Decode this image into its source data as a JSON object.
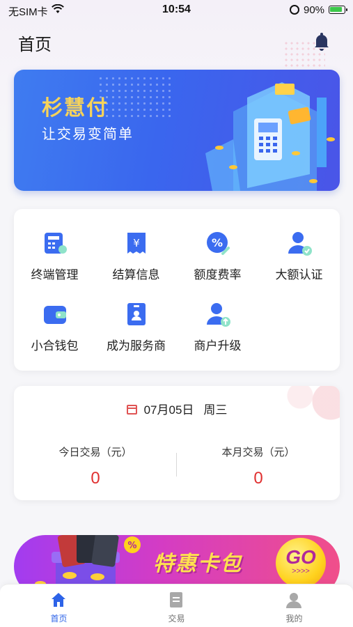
{
  "status_bar": {
    "carrier": "无SIM卡",
    "time": "10:54",
    "battery": "90%"
  },
  "header": {
    "title": "首页",
    "bell_icon": "bell-icon"
  },
  "banner": {
    "title": "杉慧付",
    "subtitle": "让交易变简单"
  },
  "features": [
    {
      "label": "终端管理",
      "icon": "terminal-icon"
    },
    {
      "label": "结算信息",
      "icon": "settlement-icon"
    },
    {
      "label": "额度费率",
      "icon": "rate-icon"
    },
    {
      "label": "大额认证",
      "icon": "verify-user-icon"
    },
    {
      "label": "小合钱包",
      "icon": "wallet-icon"
    },
    {
      "label": "成为服务商",
      "icon": "provider-card-icon"
    },
    {
      "label": "商户升级",
      "icon": "upgrade-user-icon"
    }
  ],
  "stats": {
    "date": "07月05日",
    "weekday": "周三",
    "today_label": "今日交易（元）",
    "today_value": "0",
    "month_label": "本月交易（元）",
    "month_value": "0"
  },
  "promo": {
    "text": "特惠卡包",
    "go": "GO",
    "arrows": ">>>>"
  },
  "tabbar": [
    {
      "label": "首页",
      "icon": "home-icon",
      "active": true
    },
    {
      "label": "交易",
      "icon": "transaction-icon",
      "active": false
    },
    {
      "label": "我的",
      "icon": "profile-icon",
      "active": false
    }
  ],
  "colors": {
    "accent": "#2d63e8",
    "banner_title": "#f7d35a",
    "amount": "#e03030"
  }
}
